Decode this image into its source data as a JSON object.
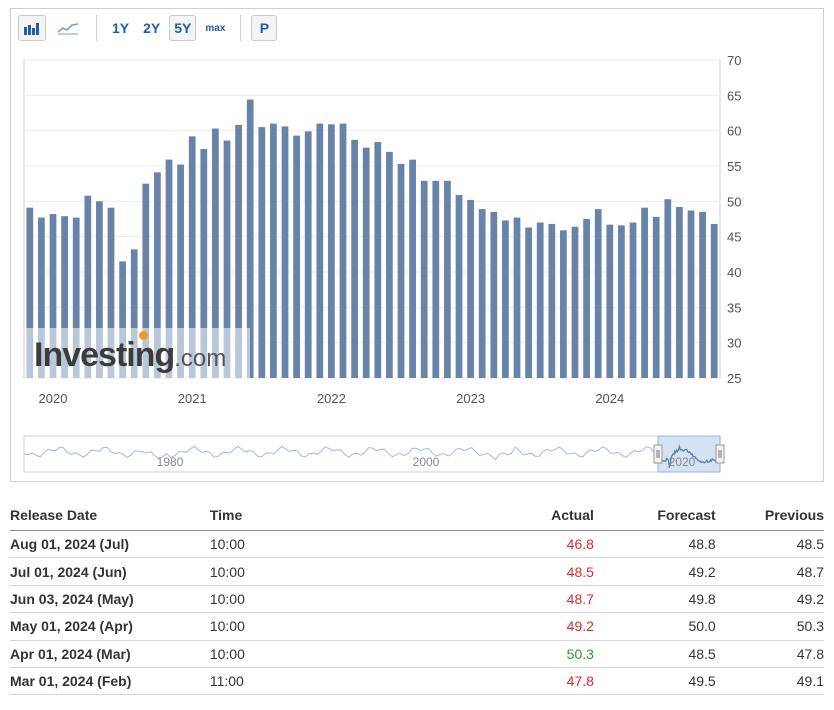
{
  "toolbar": {
    "bar_icon": "bar-chart-icon",
    "line_icon": "line-chart-icon",
    "range_buttons": [
      "1Y",
      "2Y",
      "5Y",
      "max"
    ],
    "active_range": "5Y",
    "p_label": "P"
  },
  "chart_data": {
    "type": "bar",
    "ylim": [
      25,
      70
    ],
    "y_ticks": [
      25,
      30,
      35,
      40,
      45,
      50,
      55,
      60,
      65,
      70
    ],
    "x_ticks": [
      "2020",
      "2021",
      "2022",
      "2023",
      "2024"
    ],
    "x_tick_months": [
      2,
      14,
      26,
      38,
      50
    ],
    "bar_color": "#6783a8",
    "start": "2019-12",
    "values": [
      49.1,
      47.7,
      48.2,
      47.9,
      47.7,
      50.8,
      50.0,
      49.1,
      41.5,
      43.2,
      52.5,
      54.1,
      55.9,
      55.2,
      59.2,
      57.4,
      60.3,
      58.6,
      60.8,
      64.4,
      60.5,
      61.0,
      60.6,
      59.3,
      59.9,
      61.0,
      60.9,
      61.0,
      58.7,
      57.6,
      58.4,
      57.0,
      55.3,
      55.9,
      52.9,
      52.9,
      52.9,
      50.9,
      50.2,
      48.9,
      48.5,
      47.3,
      47.7,
      46.3,
      47.0,
      46.8,
      45.9,
      46.4,
      47.5,
      48.9,
      46.7,
      46.6,
      47.0,
      49.1,
      47.8,
      50.3,
      49.2,
      48.7,
      48.5,
      46.8
    ],
    "navigator_labels": [
      "1980",
      "2000",
      "2020"
    ],
    "watermark": {
      "brand": "Investing",
      "suffix": ".com"
    }
  },
  "table": {
    "headers": [
      "Release Date",
      "Time",
      "Actual",
      "Forecast",
      "Previous"
    ],
    "rows": [
      {
        "date": "Aug 01, 2024 (Jul)",
        "time": "10:00",
        "actual": "46.8",
        "forecast": "48.8",
        "previous": "48.5",
        "actual_color": "#dd2b2b"
      },
      {
        "date": "Jul 01, 2024 (Jun)",
        "time": "10:00",
        "actual": "48.5",
        "forecast": "49.2",
        "previous": "48.7",
        "actual_color": "#dd2b2b"
      },
      {
        "date": "Jun 03, 2024 (May)",
        "time": "10:00",
        "actual": "48.7",
        "forecast": "49.8",
        "previous": "49.2",
        "actual_color": "#dd2b2b"
      },
      {
        "date": "May 01, 2024 (Apr)",
        "time": "10:00",
        "actual": "49.2",
        "forecast": "50.0",
        "previous": "50.3",
        "actual_color": "#dd2b2b"
      },
      {
        "date": "Apr 01, 2024 (Mar)",
        "time": "10:00",
        "actual": "50.3",
        "forecast": "48.5",
        "previous": "47.8",
        "actual_color": "#2d9a2d"
      },
      {
        "date": "Mar 01, 2024 (Feb)",
        "time": "11:00",
        "actual": "47.8",
        "forecast": "49.5",
        "previous": "49.1",
        "actual_color": "#dd2b2b"
      }
    ]
  }
}
